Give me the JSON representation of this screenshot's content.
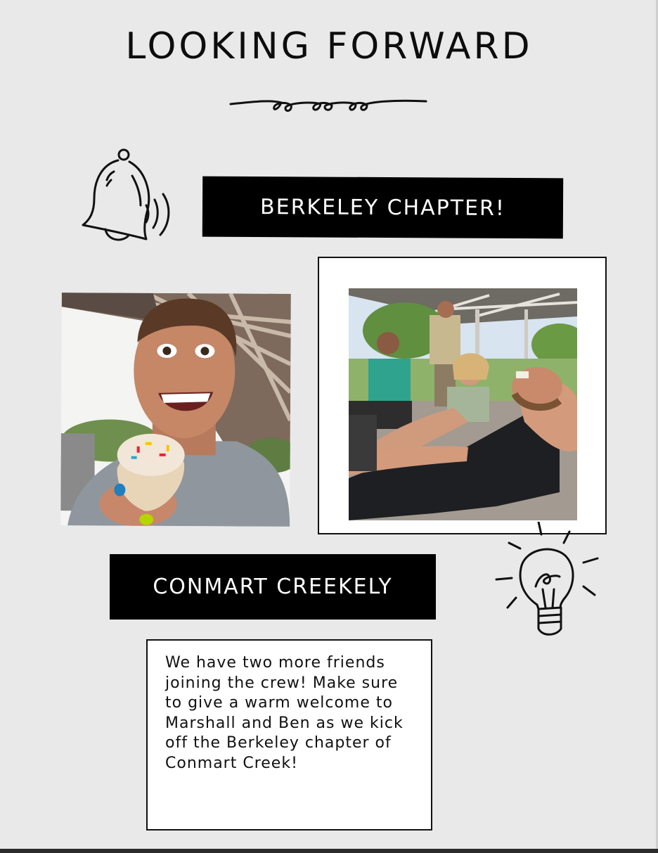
{
  "title": "LOOKING FORWARD",
  "banners": {
    "top": "BERKELEY CHAPTER!",
    "bottom": "CONMART CREEKELY"
  },
  "message": "We have two more friends joining the crew! Make sure to give a warm welcome to Marshall and Ben as we kick off the Berkeley chapter of Conmart Creek!",
  "icons": {
    "bell": "bell-icon",
    "lightbulb": "lightbulb-icon",
    "divider": "swirl-divider"
  },
  "photos": [
    {
      "name": "photo-ice-cream-selfie"
    },
    {
      "name": "photo-friends-under-pavilion"
    }
  ],
  "colors": {
    "background": "#e9e9e9",
    "banner": "#000000",
    "banner_text": "#ffffff"
  }
}
